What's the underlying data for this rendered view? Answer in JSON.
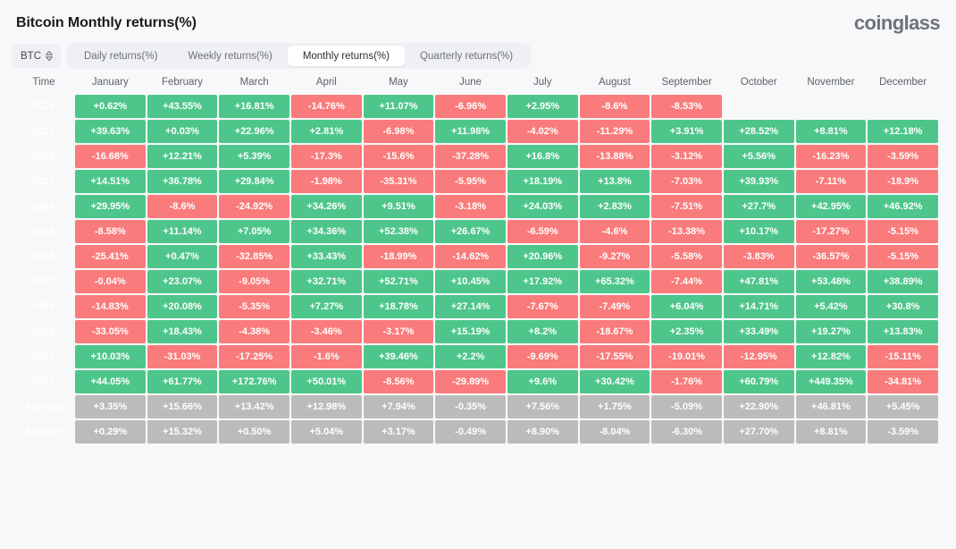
{
  "header": {
    "title": "Bitcoin Monthly returns(%)",
    "brand": "coinglass"
  },
  "controls": {
    "symbol": "BTC",
    "symbol_icon": "chevron-up-down-icon",
    "tabs": [
      {
        "label": "Daily returns(%)",
        "active": false
      },
      {
        "label": "Weekly returns(%)",
        "active": false
      },
      {
        "label": "Monthly returns(%)",
        "active": true
      },
      {
        "label": "Quarterly returns(%)",
        "active": false
      }
    ]
  },
  "colors": {
    "positive": "#4ec68b",
    "negative": "#f97b7b",
    "neutral": "#bbbbbb",
    "background": "#f7f8f9",
    "tabbar": "#eef0f3"
  },
  "chart_data": {
    "type": "heatmap",
    "title": "Bitcoin Monthly returns(%)",
    "xlabel": "",
    "ylabel": "Time",
    "grid": false,
    "legend": "none",
    "columns": [
      "Time",
      "January",
      "February",
      "March",
      "April",
      "May",
      "June",
      "July",
      "August",
      "September",
      "October",
      "November",
      "December"
    ],
    "categories": [
      "January",
      "February",
      "March",
      "April",
      "May",
      "June",
      "July",
      "August",
      "September",
      "October",
      "November",
      "December"
    ],
    "rows": [
      {
        "label": "2024",
        "kind": "year",
        "values": [
          "+0.62%",
          "+43.55%",
          "+16.81%",
          "-14.76%",
          "+11.07%",
          "-6.96%",
          "+2.95%",
          "-8.6%",
          "-8.53%",
          "",
          "",
          ""
        ]
      },
      {
        "label": "2023",
        "kind": "year",
        "values": [
          "+39.63%",
          "+0.03%",
          "+22.96%",
          "+2.81%",
          "-6.98%",
          "+11.98%",
          "-4.02%",
          "-11.29%",
          "+3.91%",
          "+28.52%",
          "+8.81%",
          "+12.18%"
        ]
      },
      {
        "label": "2022",
        "kind": "year",
        "values": [
          "-16.68%",
          "+12.21%",
          "+5.39%",
          "-17.3%",
          "-15.6%",
          "-37.28%",
          "+16.8%",
          "-13.88%",
          "-3.12%",
          "+5.56%",
          "-16.23%",
          "-3.59%"
        ]
      },
      {
        "label": "2021",
        "kind": "year",
        "values": [
          "+14.51%",
          "+36.78%",
          "+29.84%",
          "-1.98%",
          "-35.31%",
          "-5.95%",
          "+18.19%",
          "+13.8%",
          "-7.03%",
          "+39.93%",
          "-7.11%",
          "-18.9%"
        ]
      },
      {
        "label": "2020",
        "kind": "year",
        "values": [
          "+29.95%",
          "-8.6%",
          "-24.92%",
          "+34.26%",
          "+9.51%",
          "-3.18%",
          "+24.03%",
          "+2.83%",
          "-7.51%",
          "+27.7%",
          "+42.95%",
          "+46.92%"
        ]
      },
      {
        "label": "2019",
        "kind": "year",
        "values": [
          "-8.58%",
          "+11.14%",
          "+7.05%",
          "+34.36%",
          "+52.38%",
          "+26.67%",
          "-6.59%",
          "-4.6%",
          "-13.38%",
          "+10.17%",
          "-17.27%",
          "-5.15%"
        ]
      },
      {
        "label": "2018",
        "kind": "year",
        "values": [
          "-25.41%",
          "+0.47%",
          "-32.85%",
          "+33.43%",
          "-18.99%",
          "-14.62%",
          "+20.96%",
          "-9.27%",
          "-5.58%",
          "-3.83%",
          "-36.57%",
          "-5.15%"
        ]
      },
      {
        "label": "2017",
        "kind": "year",
        "values": [
          "-0.04%",
          "+23.07%",
          "-9.05%",
          "+32.71%",
          "+52.71%",
          "+10.45%",
          "+17.92%",
          "+65.32%",
          "-7.44%",
          "+47.81%",
          "+53.48%",
          "+38.89%"
        ]
      },
      {
        "label": "2016",
        "kind": "year",
        "values": [
          "-14.83%",
          "+20.08%",
          "-5.35%",
          "+7.27%",
          "+18.78%",
          "+27.14%",
          "-7.67%",
          "-7.49%",
          "+6.04%",
          "+14.71%",
          "+5.42%",
          "+30.8%"
        ]
      },
      {
        "label": "2015",
        "kind": "year",
        "values": [
          "-33.05%",
          "+18.43%",
          "-4.38%",
          "-3.46%",
          "-3.17%",
          "+15.19%",
          "+8.2%",
          "-18.67%",
          "+2.35%",
          "+33.49%",
          "+19.27%",
          "+13.83%"
        ]
      },
      {
        "label": "2014",
        "kind": "year",
        "values": [
          "+10.03%",
          "-31.03%",
          "-17.25%",
          "-1.6%",
          "+39.46%",
          "+2.2%",
          "-9.69%",
          "-17.55%",
          "-19.01%",
          "-12.95%",
          "+12.82%",
          "-15.11%"
        ]
      },
      {
        "label": "2013",
        "kind": "year",
        "values": [
          "+44.05%",
          "+61.77%",
          "+172.76%",
          "+50.01%",
          "-8.56%",
          "-29.89%",
          "+9.6%",
          "+30.42%",
          "-1.76%",
          "+60.79%",
          "+449.35%",
          "-34.81%"
        ]
      },
      {
        "label": "Average",
        "kind": "summary",
        "values": [
          "+3.35%",
          "+15.66%",
          "+13.42%",
          "+12.98%",
          "+7.94%",
          "-0.35%",
          "+7.56%",
          "+1.75%",
          "-5.09%",
          "+22.90%",
          "+46.81%",
          "+5.45%"
        ]
      },
      {
        "label": "Median",
        "kind": "summary",
        "values": [
          "+0.29%",
          "+15.32%",
          "+0.50%",
          "+5.04%",
          "+3.17%",
          "-0.49%",
          "+8.90%",
          "-8.04%",
          "-6.30%",
          "+27.70%",
          "+8.81%",
          "-3.59%"
        ]
      }
    ]
  }
}
